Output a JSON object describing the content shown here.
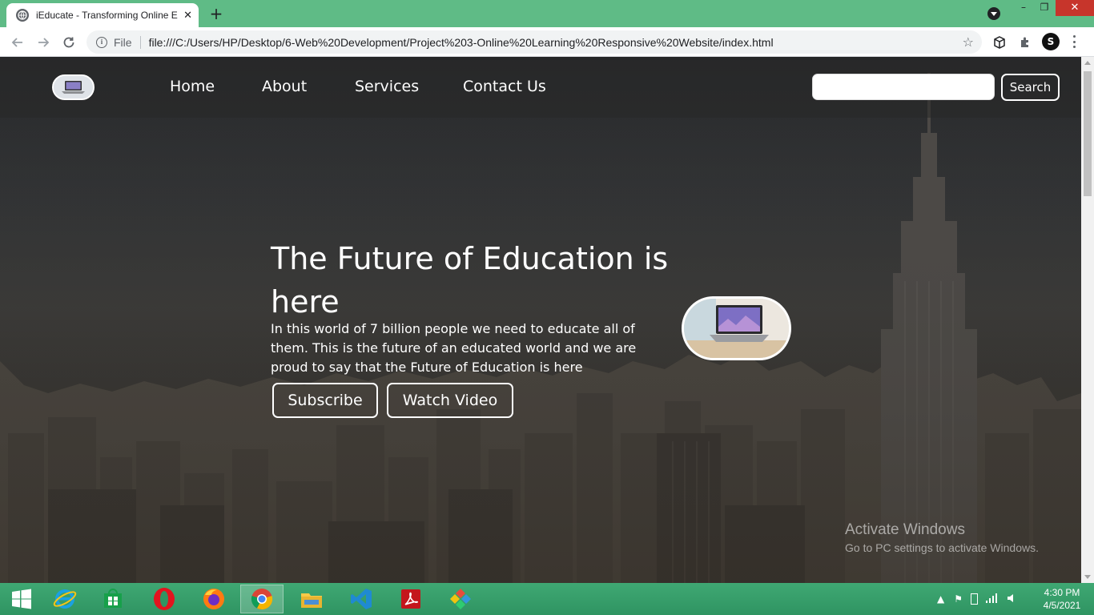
{
  "browser": {
    "tab_title": "iEducate - Transforming Online E",
    "tab_close": "✕",
    "new_tab": "+",
    "url_scheme": "File",
    "url": "file:///C:/Users/HP/Desktop/6-Web%20Development/Project%203-Online%20Learning%20Responsive%20Website/index.html",
    "window_controls": {
      "minimize": "–",
      "maximize": "❐",
      "close": "✕"
    },
    "profile_initial": "S"
  },
  "site": {
    "nav": {
      "links": [
        "Home",
        "About",
        "Services",
        "Contact Us"
      ],
      "search_placeholder": "",
      "search_button": "Search"
    },
    "hero": {
      "title": "The Future of Education is here",
      "text": "In this world of 7 billion people we need to educate all of them. This is the future of an educated world and we are proud to say that the Future of Education is here",
      "buttons": [
        "Subscribe",
        "Watch Video"
      ]
    }
  },
  "watermark": {
    "title": "Activate Windows",
    "subtitle": "Go to PC settings to activate Windows."
  },
  "taskbar": {
    "apps": [
      "windows-start",
      "internet-explorer",
      "store",
      "opera",
      "firefox",
      "chrome",
      "file-explorer",
      "vscode",
      "acrobat",
      "app-pinned"
    ],
    "active_app": "chrome",
    "time": "4:30 PM",
    "date": "4/5/2021"
  },
  "colors": {
    "titlebar": "#5fbb86",
    "taskbar": "#3fa873",
    "close_button": "#c7352b"
  }
}
